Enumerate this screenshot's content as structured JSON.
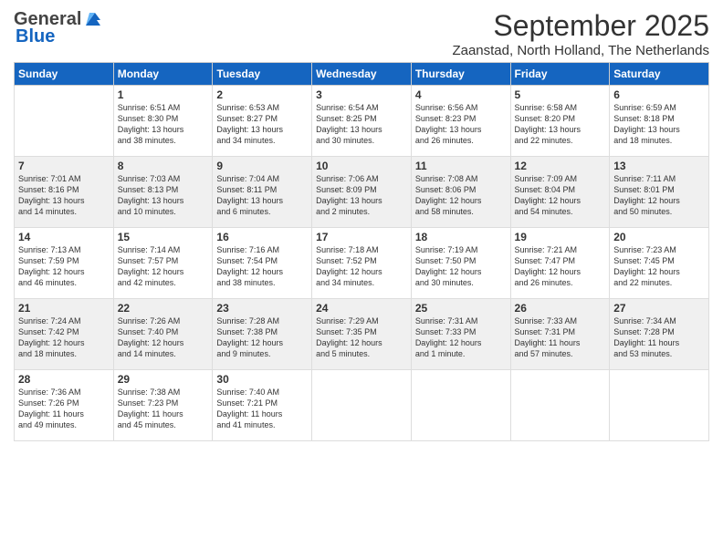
{
  "logo": {
    "general": "General",
    "blue": "Blue"
  },
  "header": {
    "month": "September 2025",
    "location": "Zaanstad, North Holland, The Netherlands"
  },
  "days": [
    "Sunday",
    "Monday",
    "Tuesday",
    "Wednesday",
    "Thursday",
    "Friday",
    "Saturday"
  ],
  "weeks": [
    [
      {
        "day": "",
        "content": ""
      },
      {
        "day": "1",
        "content": "Sunrise: 6:51 AM\nSunset: 8:30 PM\nDaylight: 13 hours\nand 38 minutes."
      },
      {
        "day": "2",
        "content": "Sunrise: 6:53 AM\nSunset: 8:27 PM\nDaylight: 13 hours\nand 34 minutes."
      },
      {
        "day": "3",
        "content": "Sunrise: 6:54 AM\nSunset: 8:25 PM\nDaylight: 13 hours\nand 30 minutes."
      },
      {
        "day": "4",
        "content": "Sunrise: 6:56 AM\nSunset: 8:23 PM\nDaylight: 13 hours\nand 26 minutes."
      },
      {
        "day": "5",
        "content": "Sunrise: 6:58 AM\nSunset: 8:20 PM\nDaylight: 13 hours\nand 22 minutes."
      },
      {
        "day": "6",
        "content": "Sunrise: 6:59 AM\nSunset: 8:18 PM\nDaylight: 13 hours\nand 18 minutes."
      }
    ],
    [
      {
        "day": "7",
        "content": "Sunrise: 7:01 AM\nSunset: 8:16 PM\nDaylight: 13 hours\nand 14 minutes."
      },
      {
        "day": "8",
        "content": "Sunrise: 7:03 AM\nSunset: 8:13 PM\nDaylight: 13 hours\nand 10 minutes."
      },
      {
        "day": "9",
        "content": "Sunrise: 7:04 AM\nSunset: 8:11 PM\nDaylight: 13 hours\nand 6 minutes."
      },
      {
        "day": "10",
        "content": "Sunrise: 7:06 AM\nSunset: 8:09 PM\nDaylight: 13 hours\nand 2 minutes."
      },
      {
        "day": "11",
        "content": "Sunrise: 7:08 AM\nSunset: 8:06 PM\nDaylight: 12 hours\nand 58 minutes."
      },
      {
        "day": "12",
        "content": "Sunrise: 7:09 AM\nSunset: 8:04 PM\nDaylight: 12 hours\nand 54 minutes."
      },
      {
        "day": "13",
        "content": "Sunrise: 7:11 AM\nSunset: 8:01 PM\nDaylight: 12 hours\nand 50 minutes."
      }
    ],
    [
      {
        "day": "14",
        "content": "Sunrise: 7:13 AM\nSunset: 7:59 PM\nDaylight: 12 hours\nand 46 minutes."
      },
      {
        "day": "15",
        "content": "Sunrise: 7:14 AM\nSunset: 7:57 PM\nDaylight: 12 hours\nand 42 minutes."
      },
      {
        "day": "16",
        "content": "Sunrise: 7:16 AM\nSunset: 7:54 PM\nDaylight: 12 hours\nand 38 minutes."
      },
      {
        "day": "17",
        "content": "Sunrise: 7:18 AM\nSunset: 7:52 PM\nDaylight: 12 hours\nand 34 minutes."
      },
      {
        "day": "18",
        "content": "Sunrise: 7:19 AM\nSunset: 7:50 PM\nDaylight: 12 hours\nand 30 minutes."
      },
      {
        "day": "19",
        "content": "Sunrise: 7:21 AM\nSunset: 7:47 PM\nDaylight: 12 hours\nand 26 minutes."
      },
      {
        "day": "20",
        "content": "Sunrise: 7:23 AM\nSunset: 7:45 PM\nDaylight: 12 hours\nand 22 minutes."
      }
    ],
    [
      {
        "day": "21",
        "content": "Sunrise: 7:24 AM\nSunset: 7:42 PM\nDaylight: 12 hours\nand 18 minutes."
      },
      {
        "day": "22",
        "content": "Sunrise: 7:26 AM\nSunset: 7:40 PM\nDaylight: 12 hours\nand 14 minutes."
      },
      {
        "day": "23",
        "content": "Sunrise: 7:28 AM\nSunset: 7:38 PM\nDaylight: 12 hours\nand 9 minutes."
      },
      {
        "day": "24",
        "content": "Sunrise: 7:29 AM\nSunset: 7:35 PM\nDaylight: 12 hours\nand 5 minutes."
      },
      {
        "day": "25",
        "content": "Sunrise: 7:31 AM\nSunset: 7:33 PM\nDaylight: 12 hours\nand 1 minute."
      },
      {
        "day": "26",
        "content": "Sunrise: 7:33 AM\nSunset: 7:31 PM\nDaylight: 11 hours\nand 57 minutes."
      },
      {
        "day": "27",
        "content": "Sunrise: 7:34 AM\nSunset: 7:28 PM\nDaylight: 11 hours\nand 53 minutes."
      }
    ],
    [
      {
        "day": "28",
        "content": "Sunrise: 7:36 AM\nSunset: 7:26 PM\nDaylight: 11 hours\nand 49 minutes."
      },
      {
        "day": "29",
        "content": "Sunrise: 7:38 AM\nSunset: 7:23 PM\nDaylight: 11 hours\nand 45 minutes."
      },
      {
        "day": "30",
        "content": "Sunrise: 7:40 AM\nSunset: 7:21 PM\nDaylight: 11 hours\nand 41 minutes."
      },
      {
        "day": "",
        "content": ""
      },
      {
        "day": "",
        "content": ""
      },
      {
        "day": "",
        "content": ""
      },
      {
        "day": "",
        "content": ""
      }
    ]
  ],
  "row_shading": [
    false,
    true,
    false,
    true,
    false
  ]
}
